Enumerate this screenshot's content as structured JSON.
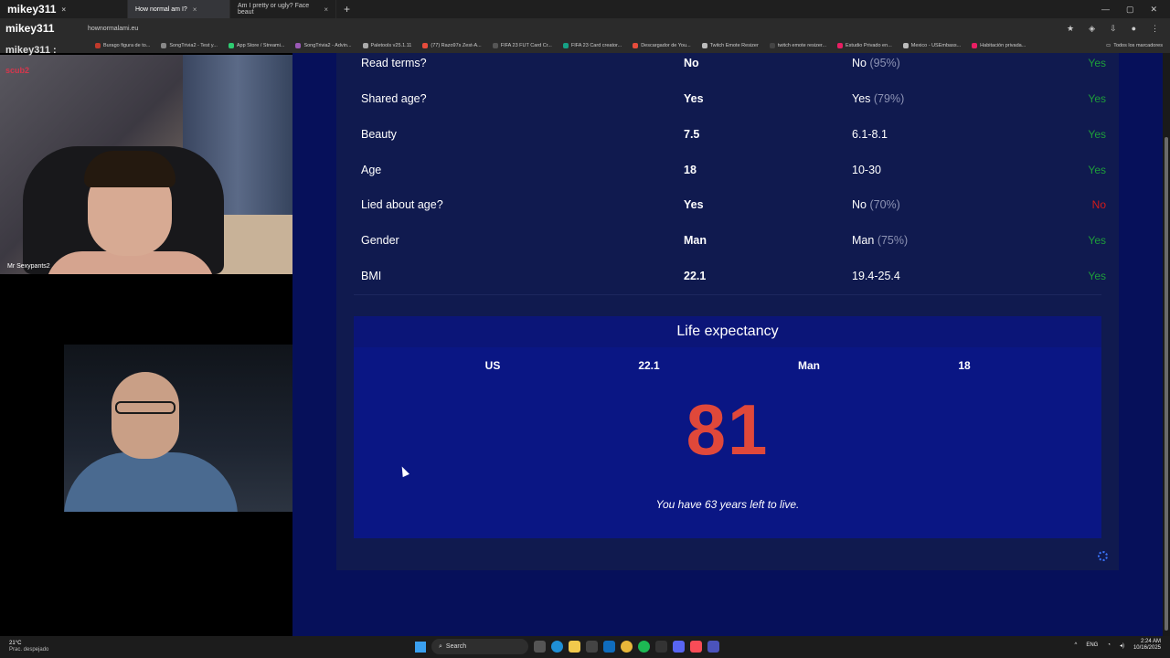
{
  "browser": {
    "tabs": [
      {
        "label": "mikey311",
        "close": "×"
      },
      {
        "label": "How normal am I?",
        "close": "×"
      },
      {
        "label": "Am I pretty or ugly? Face beaut",
        "close": "×"
      }
    ],
    "new_tab": "+",
    "address_brand": "mikey311",
    "url": "hownormalami.eu",
    "bookmarks": [
      {
        "label": "Burago figura de to...",
        "color": "#c0392b"
      },
      {
        "label": "SongTrivia2 - Test y...",
        "color": "#888888"
      },
      {
        "label": "App Store / Streami...",
        "color": "#2ecc71"
      },
      {
        "label": "SongTrivia2 - Advin...",
        "color": "#9b59b6"
      },
      {
        "label": "Paletools v25.1.11",
        "color": "#aaaaaa"
      },
      {
        "label": "(77) Razo97s Zest-A...",
        "color": "#e74c3c"
      },
      {
        "label": "FIFA 23 FUT Card Cr...",
        "color": "#555555"
      },
      {
        "label": "FIFA 23 Card creator...",
        "color": "#16a085"
      },
      {
        "label": "Descargador de You...",
        "color": "#e74c3c"
      },
      {
        "label": "Twitch Emote Resizer",
        "color": "#bbbbbb"
      },
      {
        "label": "twitch emote resizer...",
        "color": "#444444"
      },
      {
        "label": "Estudio Privado en...",
        "color": "#e91e63"
      },
      {
        "label": "Mexico - USEmbass...",
        "color": "#bbbbbb"
      },
      {
        "label": "Habitación privada...",
        "color": "#e91e63"
      }
    ],
    "bookmarks_folder": "Todos los marcadores"
  },
  "results": [
    {
      "label": "Read terms?",
      "value": "No",
      "average": "No",
      "pct": "(95%)",
      "result": "Yes",
      "status": "yes"
    },
    {
      "label": "Shared age?",
      "value": "Yes",
      "average": "Yes",
      "pct": "(79%)",
      "result": "Yes",
      "status": "yes"
    },
    {
      "label": "Beauty",
      "value": "7.5",
      "average": "6.1-8.1",
      "pct": "",
      "result": "Yes",
      "status": "yes"
    },
    {
      "label": "Age",
      "value": "18",
      "average": "10-30",
      "pct": "",
      "result": "Yes",
      "status": "yes"
    },
    {
      "label": "Lied about age?",
      "value": "Yes",
      "average": "No",
      "pct": "(70%)",
      "result": "No",
      "status": "no"
    },
    {
      "label": "Gender",
      "value": "Man",
      "average": "Man",
      "pct": "(75%)",
      "result": "Yes",
      "status": "yes"
    },
    {
      "label": "BMI",
      "value": "22.1",
      "average": "19.4-25.4",
      "pct": "",
      "result": "Yes",
      "status": "yes"
    }
  ],
  "life": {
    "title": "Life expectancy",
    "country": "US",
    "bmi": "22.1",
    "gender": "Man",
    "age": "18",
    "expectancy": "81",
    "message": "You have 63 years left to live."
  },
  "overlay": {
    "title": "mikey311 :",
    "subtitle": "scub2",
    "cam_label": "Mr Sexypants2"
  },
  "taskbar": {
    "temp": "21°C",
    "weather": "Prac. despejado",
    "search": "Search",
    "lang": "ENG",
    "time": "2:24 AM",
    "date": "10/16/2025"
  },
  "colors": {
    "page_bg": "#06105a",
    "card_bg": "#101a4f",
    "life_bg": "#0a1684",
    "yes": "#1e9d3a",
    "no": "#d21a1a",
    "expectancy": "#e0483a"
  }
}
